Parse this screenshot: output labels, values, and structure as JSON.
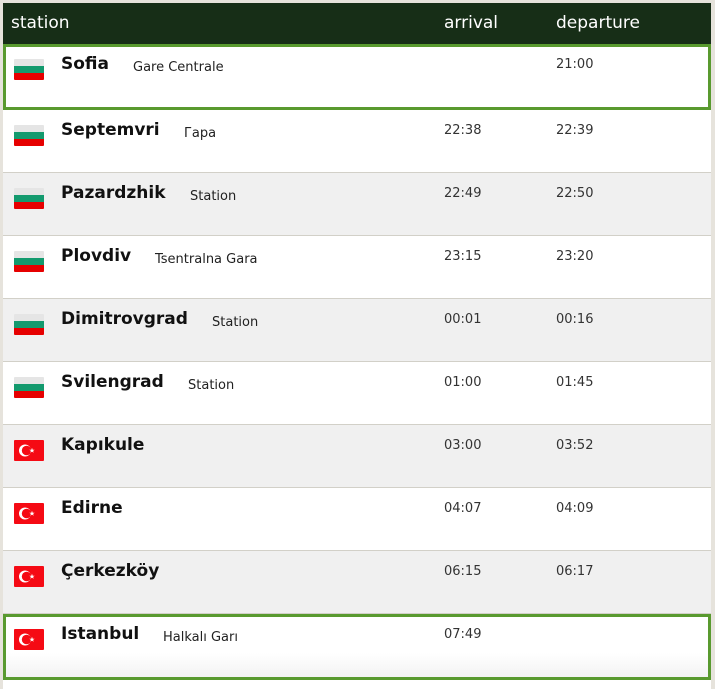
{
  "header": {
    "station": "station",
    "arrival": "arrival",
    "departure": "departure"
  },
  "colors": {
    "header_bg": "#172e17",
    "highlight_border": "#599a2f"
  },
  "stops": [
    {
      "flag": "bulgaria-flag-icon",
      "name": "Sofia",
      "station": "Gare Centrale",
      "arrival": "",
      "departure": "21:00",
      "highlighted": true
    },
    {
      "flag": "bulgaria-flag-icon",
      "name": "Septemvri",
      "station": "Гара",
      "arrival": "22:38",
      "departure": "22:39"
    },
    {
      "flag": "bulgaria-flag-icon",
      "name": "Pazardzhik",
      "station": "Station",
      "arrival": "22:49",
      "departure": "22:50"
    },
    {
      "flag": "bulgaria-flag-icon",
      "name": "Plovdiv",
      "station": "Tsentralna Gara",
      "arrival": "23:15",
      "departure": "23:20"
    },
    {
      "flag": "bulgaria-flag-icon",
      "name": "Dimitrovgrad",
      "station": "Station",
      "arrival": "00:01",
      "departure": "00:16"
    },
    {
      "flag": "bulgaria-flag-icon",
      "name": "Svilengrad",
      "station": "Station",
      "arrival": "01:00",
      "departure": "01:45"
    },
    {
      "flag": "turkey-flag-icon",
      "name": "Kapıkule",
      "station": "",
      "arrival": "03:00",
      "departure": "03:52"
    },
    {
      "flag": "turkey-flag-icon",
      "name": "Edirne",
      "station": "",
      "arrival": "04:07",
      "departure": "04:09"
    },
    {
      "flag": "turkey-flag-icon",
      "name": "Çerkezköy",
      "station": "",
      "arrival": "06:15",
      "departure": "06:17"
    },
    {
      "flag": "turkey-flag-icon",
      "name": "Istanbul",
      "station": "Halkalı Garı",
      "arrival": "07:49",
      "departure": "",
      "highlighted": true
    }
  ]
}
